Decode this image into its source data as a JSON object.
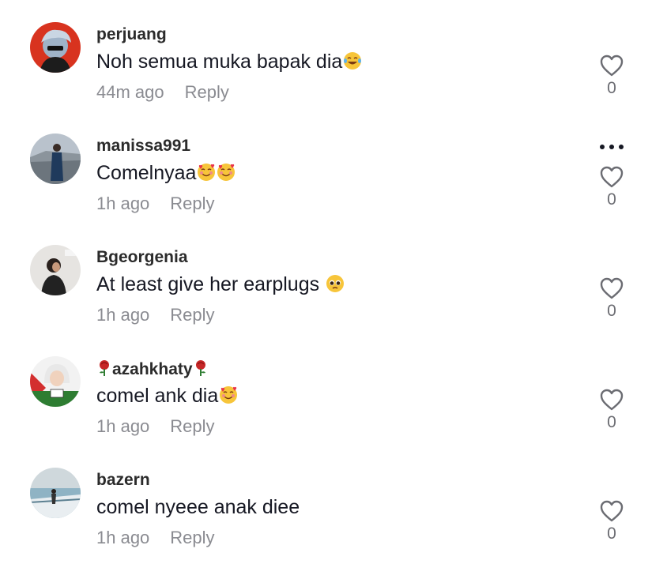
{
  "comments": [
    {
      "username": "perjuang",
      "text": "Noh semua muka bapak dia",
      "emoji": [
        "laughing-tears-emoji"
      ],
      "time": "44m ago",
      "reply_label": "Reply",
      "likes": "0",
      "has_more_menu": false
    },
    {
      "username": "manissa991",
      "text": "Comelnyaa",
      "emoji": [
        "smiling-face-with-hearts-emoji",
        "smiling-face-with-hearts-emoji"
      ],
      "time": "1h ago",
      "reply_label": "Reply",
      "likes": "0",
      "has_more_menu": true
    },
    {
      "username": "Bgeorgenia",
      "text": "At least give her earplugs ",
      "emoji": [
        "pleading-face-emoji"
      ],
      "time": "1h ago",
      "reply_label": "Reply",
      "likes": "0",
      "has_more_menu": false
    },
    {
      "username": "azahkhaty",
      "username_decoration": "rose-emoji",
      "text": "comel ank dia",
      "emoji": [
        "smiling-face-with-hearts-emoji"
      ],
      "time": "1h ago",
      "reply_label": "Reply",
      "likes": "0",
      "has_more_menu": false
    },
    {
      "username": "bazern",
      "text": "comel nyeee anak diee",
      "emoji": [],
      "time": "1h ago",
      "reply_label": "Reply",
      "likes": "0",
      "has_more_menu": false
    }
  ],
  "colors": {
    "username": "#2b2b2b",
    "text": "#161823",
    "meta": "#8a8b91",
    "heart_stroke": "#6b6c72"
  }
}
